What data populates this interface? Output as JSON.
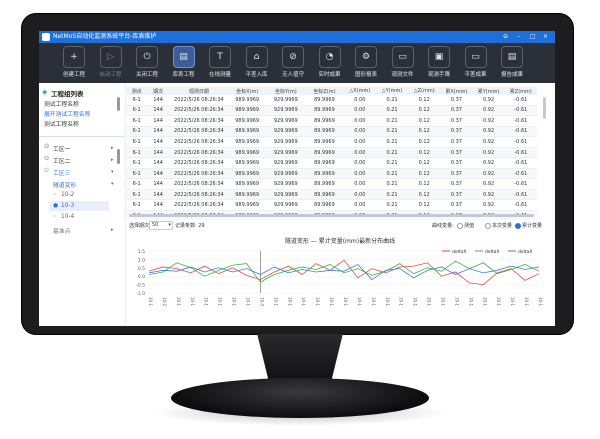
{
  "window": {
    "title": "NetMoS自动化监测系统平台-库表维护"
  },
  "toolbar": [
    {
      "label": "创建工程",
      "icon": "plus-icon",
      "glyph": "+",
      "state": "normal"
    },
    {
      "label": "启动工程",
      "icon": "play-icon",
      "glyph": "▷",
      "state": "disabled"
    },
    {
      "label": "关闭工程",
      "icon": "power-icon",
      "glyph": "⏻",
      "state": "normal"
    },
    {
      "label": "库表工程",
      "icon": "table-icon",
      "glyph": "▤",
      "state": "active"
    },
    {
      "label": "在线测量",
      "icon": "total-station-icon",
      "glyph": "T",
      "state": "normal"
    },
    {
      "label": "平差入库",
      "icon": "home-icon",
      "glyph": "⌂",
      "state": "normal"
    },
    {
      "label": "无人值守",
      "icon": "no-entry-icon",
      "glyph": "⊘",
      "state": "normal"
    },
    {
      "label": "实时成果",
      "icon": "pie-chart-icon",
      "glyph": "◔",
      "state": "normal"
    },
    {
      "label": "图形报表",
      "icon": "gear-icon",
      "glyph": "⚙",
      "state": "normal"
    },
    {
      "label": "观测文件",
      "icon": "folder-icon",
      "glyph": "▭",
      "state": "normal"
    },
    {
      "label": "观测手簿",
      "icon": "notebook-icon",
      "glyph": "▣",
      "state": "normal"
    },
    {
      "label": "平差成果",
      "icon": "folder-chart-icon",
      "glyph": "▭",
      "state": "normal"
    },
    {
      "label": "报告成果",
      "icon": "report-icon",
      "glyph": "▤",
      "state": "normal"
    }
  ],
  "project_list": {
    "header": "工程组列表",
    "items": [
      "测试工程名称",
      "展开测试工程名称",
      "测试工程名称"
    ]
  },
  "tree": {
    "groups": [
      {
        "label": "工区一"
      },
      {
        "label": "工区二"
      },
      {
        "label": "工区三"
      }
    ],
    "subgroup": "隧道变形",
    "points": [
      "10-2",
      "10-3",
      "10-4"
    ],
    "base": "基准点"
  },
  "table": {
    "columns": [
      "测点",
      "期次",
      "观测日期",
      "坐标X(m)",
      "坐标Y(m)",
      "坐标Z(m)",
      "△X(mm)",
      "△Y(mm)",
      "△Z(mm)",
      "累X(mm)",
      "累Y(mm)",
      "累Z(mm)"
    ],
    "rows": [
      [
        "6-1",
        "144",
        "2022/5/26 08:26:34",
        "989.9969",
        "929.9969",
        "89.9969",
        "0.00",
        "0.21",
        "0.12",
        "0.37",
        "0.92",
        "-0.61"
      ],
      [
        "6-1",
        "144",
        "2022/5/26 08:26:34",
        "989.9969",
        "929.9969",
        "89.9969",
        "0.00",
        "0.21",
        "0.12",
        "0.37",
        "0.92",
        "-0.61"
      ],
      [
        "6-1",
        "144",
        "2022/5/26 08:26:34",
        "989.9969",
        "929.9969",
        "89.9969",
        "0.00",
        "0.21",
        "0.12",
        "0.37",
        "0.92",
        "-0.61"
      ],
      [
        "6-1",
        "144",
        "2022/5/26 08:26:34",
        "989.9969",
        "929.9969",
        "89.9969",
        "0.00",
        "0.21",
        "0.12",
        "0.37",
        "0.92",
        "-0.61"
      ],
      [
        "6-1",
        "144",
        "2022/5/26 08:26:34",
        "989.9969",
        "929.9969",
        "89.9969",
        "0.00",
        "0.21",
        "0.12",
        "0.37",
        "0.92",
        "-0.61"
      ],
      [
        "6-1",
        "144",
        "2022/5/26 08:26:34",
        "989.9969",
        "929.9969",
        "89.9969",
        "0.00",
        "0.21",
        "0.12",
        "0.37",
        "0.92",
        "-0.61"
      ],
      [
        "6-1",
        "144",
        "2022/5/26 08:26:34",
        "989.9969",
        "929.9969",
        "89.9969",
        "0.00",
        "0.21",
        "0.12",
        "0.37",
        "0.92",
        "-0.61"
      ],
      [
        "6-1",
        "144",
        "2022/5/26 08:26:34",
        "989.9969",
        "929.9969",
        "89.9969",
        "0.00",
        "0.21",
        "0.12",
        "0.37",
        "0.92",
        "-0.61"
      ],
      [
        "6-1",
        "144",
        "2022/5/26 08:26:34",
        "989.9969",
        "929.9969",
        "89.9969",
        "0.00",
        "0.21",
        "0.12",
        "0.37",
        "0.92",
        "-0.61"
      ],
      [
        "6-1",
        "144",
        "2022/5/26 08:26:34",
        "989.9969",
        "929.9969",
        "89.9969",
        "0.00",
        "0.21",
        "0.12",
        "0.37",
        "0.92",
        "-0.61"
      ],
      [
        "6-1",
        "144",
        "2022/5/26 08:26:34",
        "989.9969",
        "929.9969",
        "89.9969",
        "0.00",
        "0.21",
        "0.12",
        "0.37",
        "0.92",
        "-0.61"
      ],
      [
        "6-1",
        "144",
        "2022/5/26 08:26:34",
        "989.9969",
        "929.9969",
        "89.9969",
        "0.00",
        "0.21",
        "0.12",
        "0.37",
        "0.92",
        "-0.61"
      ]
    ]
  },
  "chart_controls": {
    "period_label": "选择期次:",
    "period_value": "50",
    "count_label": "记录条数: 29",
    "curve_label": "曲线变量:",
    "options": [
      "测值",
      "本次变量",
      "累计变量"
    ],
    "selected_option": 2
  },
  "chart_data": {
    "type": "line",
    "title": "隧道变形 — 累计变量(mm)最新分布曲线",
    "ylim": [
      -1.0,
      1.5
    ],
    "yticks": [
      "1.5",
      "1.0",
      "0.5",
      "0.0",
      "-0.5",
      "-1.0"
    ],
    "categories": [
      "10-1",
      "10-2",
      "10-3",
      "10-4",
      "10-5",
      "10-6",
      "10-7",
      "10-8",
      "10-9",
      "10-10",
      "10-11",
      "10-12",
      "10-13",
      "10-14",
      "10-15",
      "10-16",
      "10-17",
      "10-18",
      "10-19",
      "10-20",
      "10-21",
      "10-22",
      "10-23",
      "10-24",
      "10-25",
      "10-26",
      "10-27",
      "10-28",
      "10-29"
    ],
    "x_tick_labels": [
      "10-1",
      "10-2",
      "10-1",
      "10-1",
      "10-1",
      "10-1",
      "10-1",
      "10-1",
      "10-3",
      "10-1",
      "10-1",
      "10-1",
      "10-1",
      "10-1",
      "10-1",
      "10-1",
      "10-1",
      "10-1",
      "10-1",
      "10-1",
      "10-1",
      "10-1",
      "10-1",
      "10-1",
      "10-1",
      "10-1",
      "10-1",
      "10-1",
      "10-1"
    ],
    "marker_index": 8,
    "series": [
      {
        "name": "deltaX",
        "color": "#e84a4a",
        "values": [
          0.3,
          0.55,
          0.45,
          0.2,
          0.6,
          0.15,
          0.5,
          0.05,
          -0.2,
          0.25,
          0.6,
          0.1,
          0.75,
          0.35,
          0.95,
          -0.1,
          0.45,
          0.2,
          0.55,
          0.6,
          0.8,
          0.0,
          0.25,
          -0.4,
          -0.5,
          0.2,
          0.45,
          -0.25,
          0.15
        ]
      },
      {
        "name": "deltaX",
        "color": "#3cb548",
        "values": [
          0.1,
          0.25,
          0.8,
          0.5,
          0.0,
          0.35,
          0.65,
          0.75,
          -0.35,
          0.1,
          0.35,
          0.55,
          0.4,
          0.7,
          0.2,
          0.45,
          0.05,
          0.3,
          0.75,
          0.15,
          0.5,
          0.3,
          0.9,
          0.45,
          0.8,
          0.15,
          0.4,
          0.7,
          0.3
        ]
      },
      {
        "name": "deltaX",
        "color": "#3b7fe0",
        "values": [
          0.2,
          0.35,
          0.3,
          0.55,
          0.25,
          0.5,
          0.25,
          0.45,
          0.1,
          0.55,
          0.2,
          0.4,
          0.25,
          0.35,
          0.3,
          0.7,
          -0.2,
          0.35,
          0.45,
          -0.1,
          0.35,
          0.55,
          0.1,
          0.45,
          0.2,
          0.35,
          0.6,
          0.4,
          0.55
        ]
      }
    ]
  }
}
